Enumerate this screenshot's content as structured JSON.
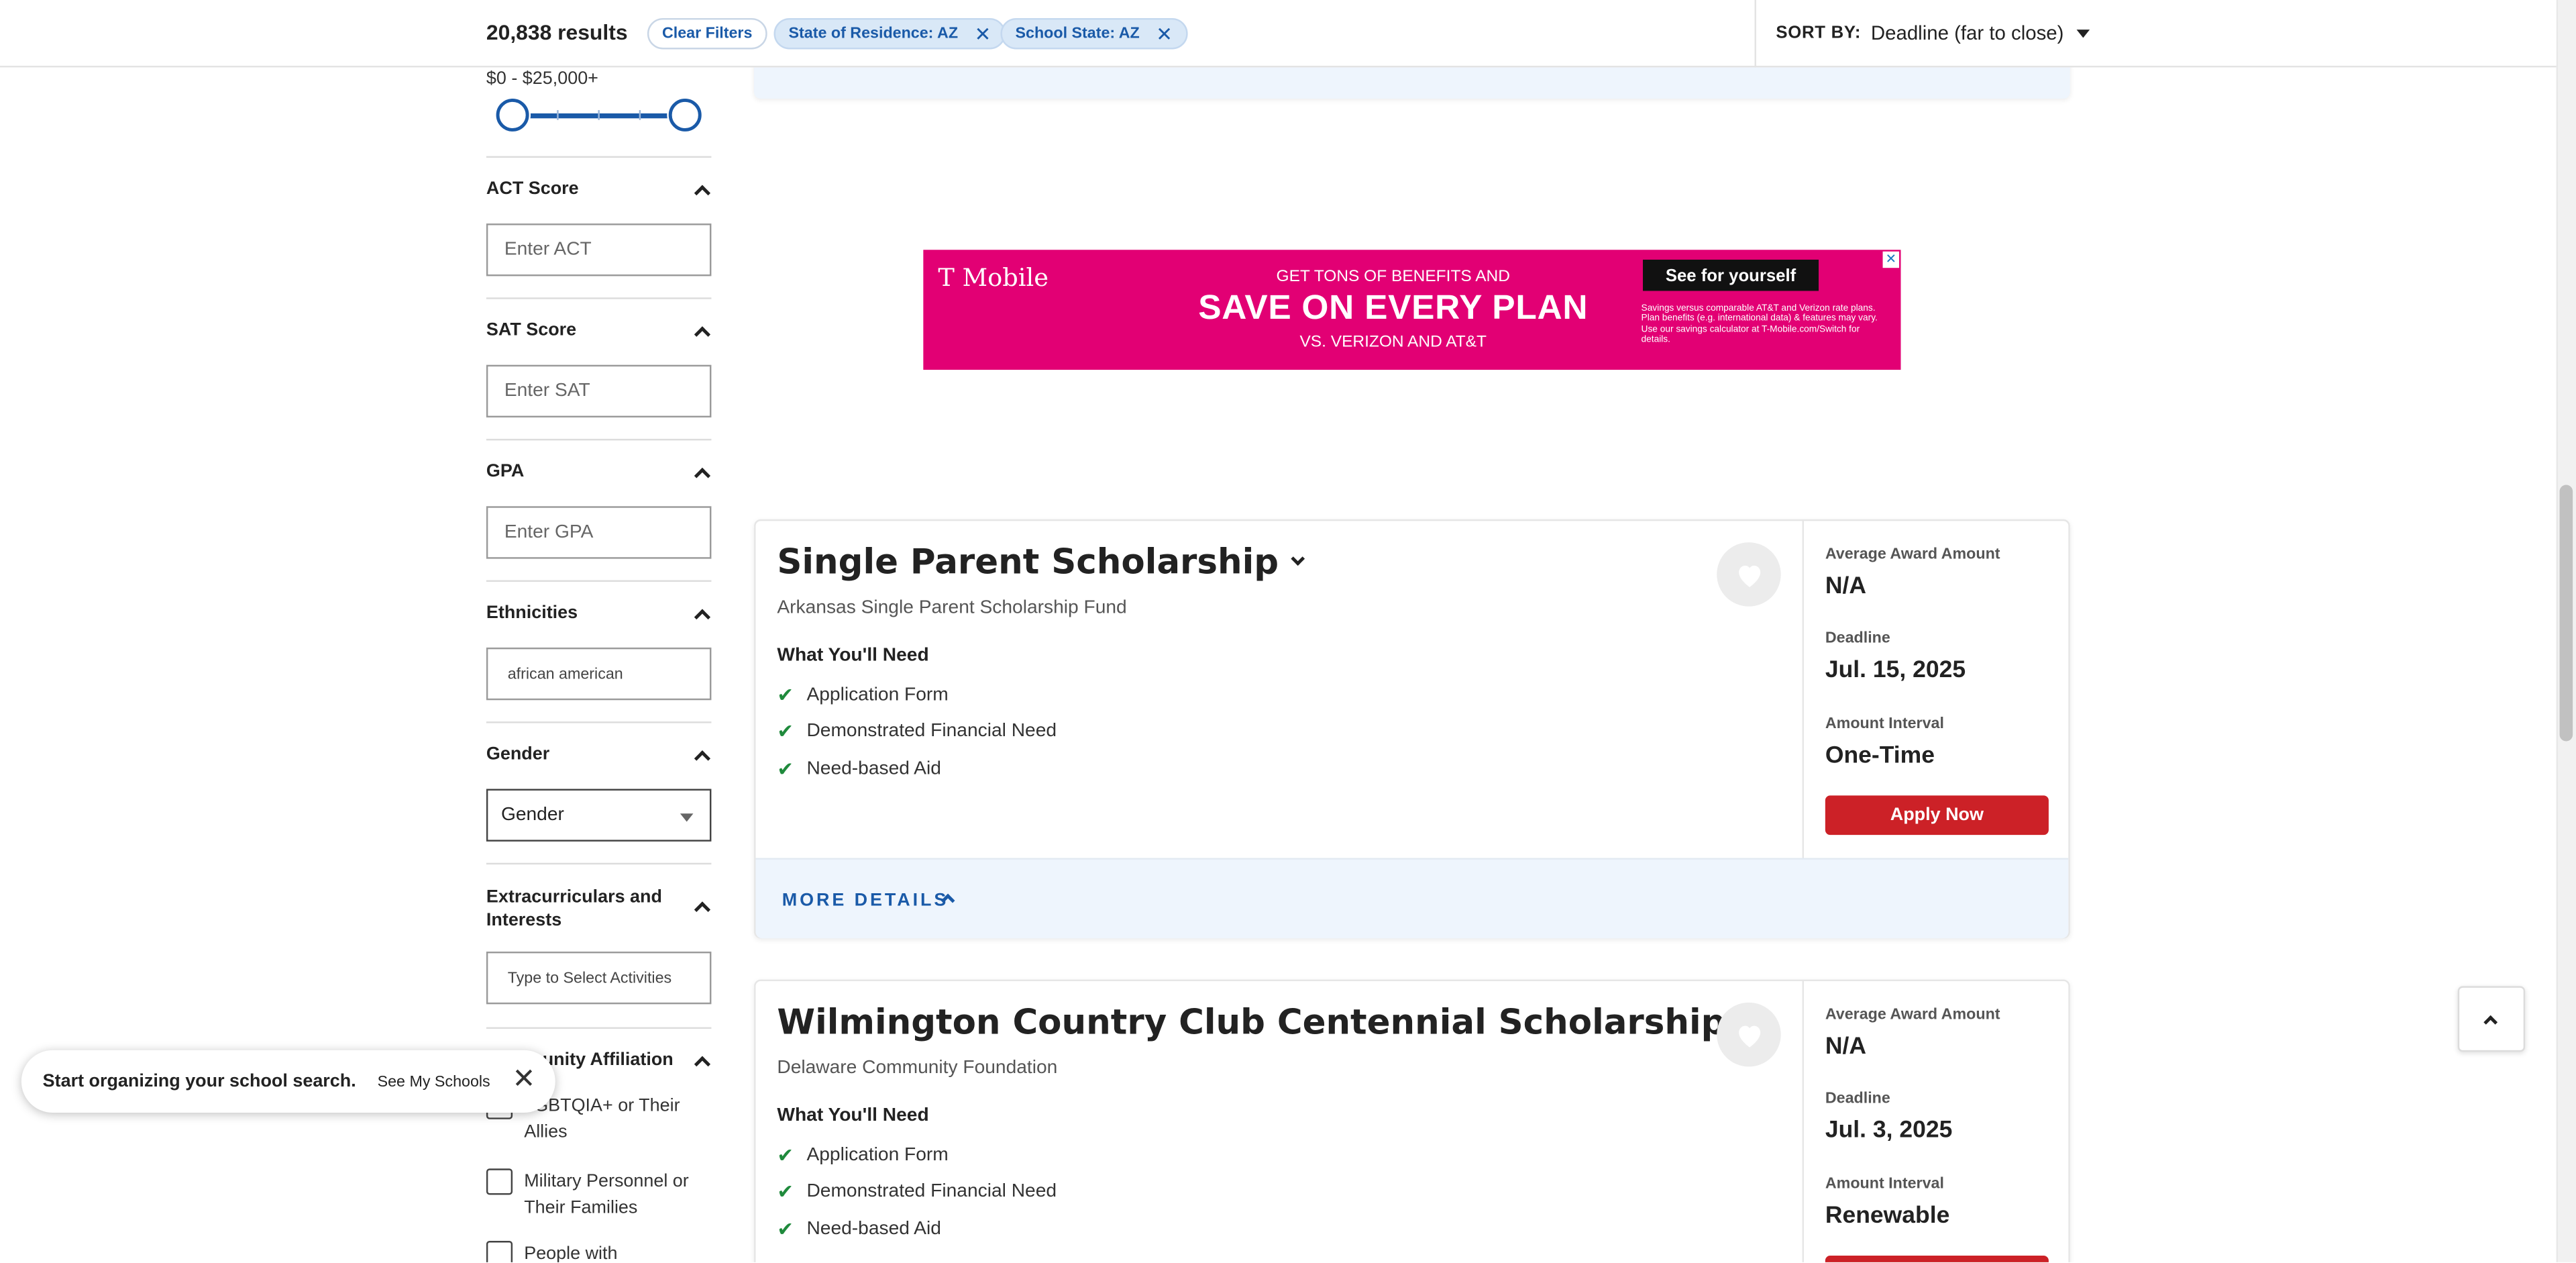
{
  "header": {
    "results": "20,838 results",
    "clear_filters": "Clear Filters",
    "filters": [
      "State of Residence: AZ",
      "School State: AZ"
    ],
    "sort_label": "SORT BY:",
    "sort_value": "Deadline (far to close)"
  },
  "sidebar": {
    "award_range": "$0 - $25,000+",
    "act": {
      "title": "ACT Score",
      "placeholder": "Enter ACT"
    },
    "sat": {
      "title": "SAT Score",
      "placeholder": "Enter SAT"
    },
    "gpa": {
      "title": "GPA",
      "placeholder": "Enter GPA"
    },
    "ethnicities": {
      "title": "Ethnicities",
      "value": "african american"
    },
    "gender": {
      "title": "Gender",
      "value": "Gender"
    },
    "extracurriculars": {
      "title": "Extracurriculars and Interests",
      "placeholder": "Type to Select Activities"
    },
    "community": {
      "title": "Community Affiliation",
      "options": [
        "LGBTQIA+ or Their Allies",
        "Military Personnel or Their Families",
        "People with"
      ]
    }
  },
  "toast": {
    "message": "Start organizing your school search.",
    "link": "See My Schools",
    "close": "✕"
  },
  "ad": {
    "brand": "T Mobile",
    "line1": "GET TONS OF BENEFITS AND",
    "line2": "SAVE ON EVERY PLAN",
    "line3": "VS. VERIZON AND AT&T",
    "cta": "See for yourself",
    "fine_print": "Savings versus comparable AT&T and Verizon rate plans. Plan benefits (e.g. international data) & features may vary. Use our savings calculator at T-Mobile.com/Switch for details.",
    "close": "✕"
  },
  "labels": {
    "need": "What You'll Need",
    "avg_award": "Average Award Amount",
    "deadline": "Deadline",
    "interval": "Amount Interval",
    "apply": "Apply Now",
    "more": "MORE DETAILS"
  },
  "scholarships": [
    {
      "title": "Single Parent Scholarship",
      "org": "Arkansas Single Parent Scholarship Fund",
      "needs": [
        "Application Form",
        "Demonstrated Financial Need",
        "Need-based Aid"
      ],
      "avg_award": "N/A",
      "deadline": "Jul. 15, 2025",
      "interval": "One-Time"
    },
    {
      "title": "Wilmington Country Club Centennial Scholarship",
      "org": "Delaware Community Foundation",
      "needs": [
        "Application Form",
        "Demonstrated Financial Need",
        "Need-based Aid"
      ],
      "avg_award": "N/A",
      "deadline": "Jul. 3, 2025",
      "interval": "Renewable"
    }
  ],
  "colors": {
    "accent": "#1a5aa8",
    "apply": "#cc2127",
    "ad_bg": "#e20074"
  }
}
